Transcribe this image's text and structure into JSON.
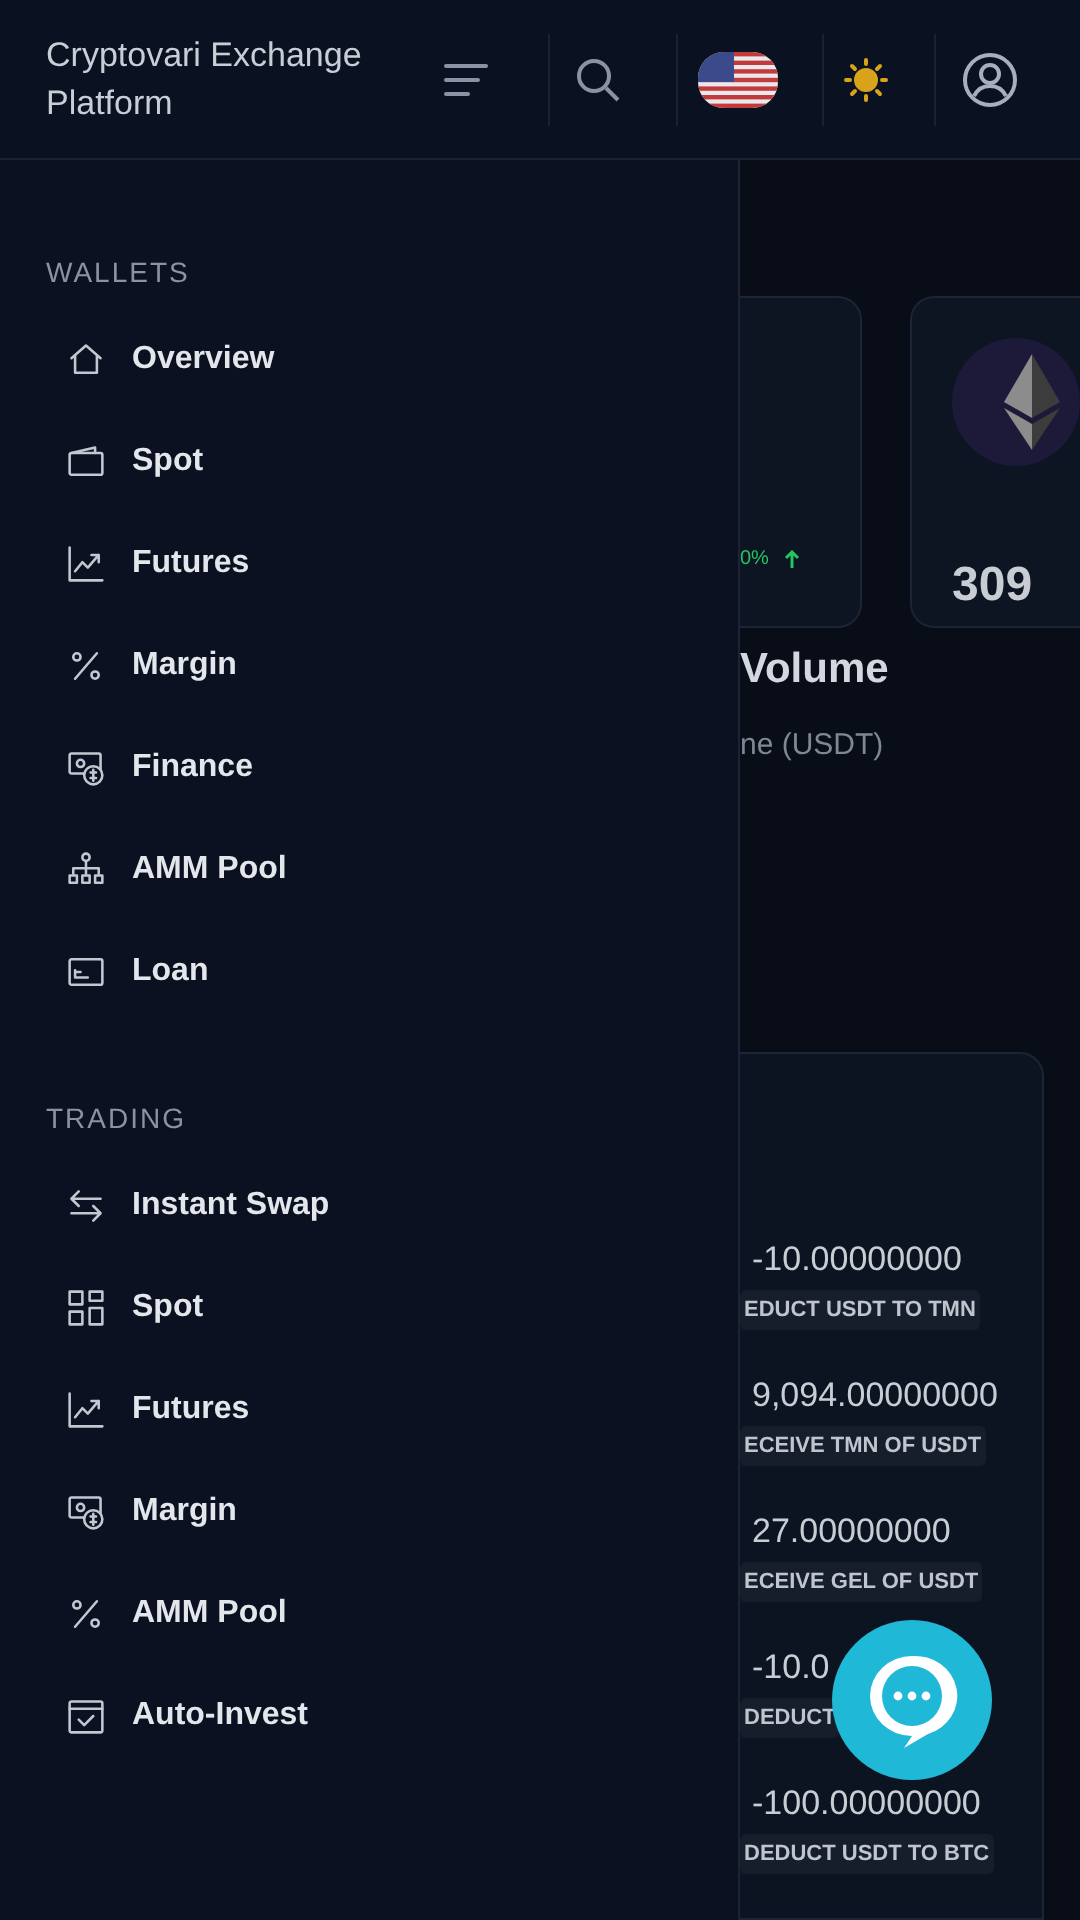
{
  "header": {
    "title": "Cryptovari Exchange Platform"
  },
  "sidebar": {
    "sections": [
      {
        "heading": "WALLETS",
        "items": [
          {
            "label": "Overview"
          },
          {
            "label": "Spot"
          },
          {
            "label": "Futures"
          },
          {
            "label": "Margin"
          },
          {
            "label": "Finance"
          },
          {
            "label": "AMM Pool"
          },
          {
            "label": "Loan"
          }
        ]
      },
      {
        "heading": "TRADING",
        "items": [
          {
            "label": "Instant Swap"
          },
          {
            "label": "Spot"
          },
          {
            "label": "Futures"
          },
          {
            "label": "Margin"
          },
          {
            "label": "AMM Pool"
          },
          {
            "label": "Auto-Invest"
          }
        ]
      }
    ]
  },
  "content": {
    "cards": [
      {
        "kind": "change",
        "text": "0%"
      },
      {
        "kind": "coin",
        "text": "309"
      }
    ],
    "heading": "Volume",
    "subtitle": "ne (USDT)",
    "transactions": [
      {
        "amount": "-10.00000000",
        "label": "EDUCT USDT TO TMN"
      },
      {
        "amount": "9,094.00000000",
        "label": "ECEIVE TMN OF USDT"
      },
      {
        "amount": "27.00000000",
        "label": "ECEIVE GEL OF USDT"
      },
      {
        "amount": "-10.0",
        "label": "DEDUCT"
      },
      {
        "amount": "-100.00000000",
        "label": "DEDUCT USDT TO BTC"
      }
    ]
  }
}
